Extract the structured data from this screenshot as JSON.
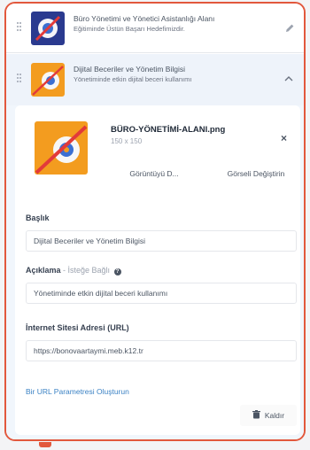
{
  "items": [
    {
      "title": "Büro Yönetimi ve Yönetici Asistanlığı Alanı",
      "subtitle": "Eğitiminde Üstün Başarı Hedefimizdir.",
      "icon": "edit-icon"
    },
    {
      "title": "Dijital Beceriler ve Yönetim Bilgisi",
      "subtitle": "Yönetiminde etkin dijital beceri kullanımı",
      "icon": "chevron-up-icon"
    }
  ],
  "image": {
    "file_name": "BÜRO-YÖNETİMİ-ALANI.png",
    "dimensions": "150 x 150",
    "view_button": "Görüntüyü D...",
    "change_button": "Görseli Değiştirin",
    "close": "×"
  },
  "form": {
    "title_label": "Başlık",
    "title_value": "Dijital Beceriler ve Yönetim Bilgisi",
    "desc_label": "Açıklama",
    "desc_optional": " - İsteğe Bağlı",
    "desc_value": "Yönetiminde etkin dijital beceri kullanımı",
    "url_label": "İnternet Sitesi Adresi (URL)",
    "url_value": "https://bonovaartaymi.meb.k12.tr",
    "url_param_link": "Bir URL Parametresi Oluşturun",
    "remove_label": "Kaldır"
  },
  "colors": {
    "accent": "#e2583d",
    "link": "#3b82c4"
  }
}
